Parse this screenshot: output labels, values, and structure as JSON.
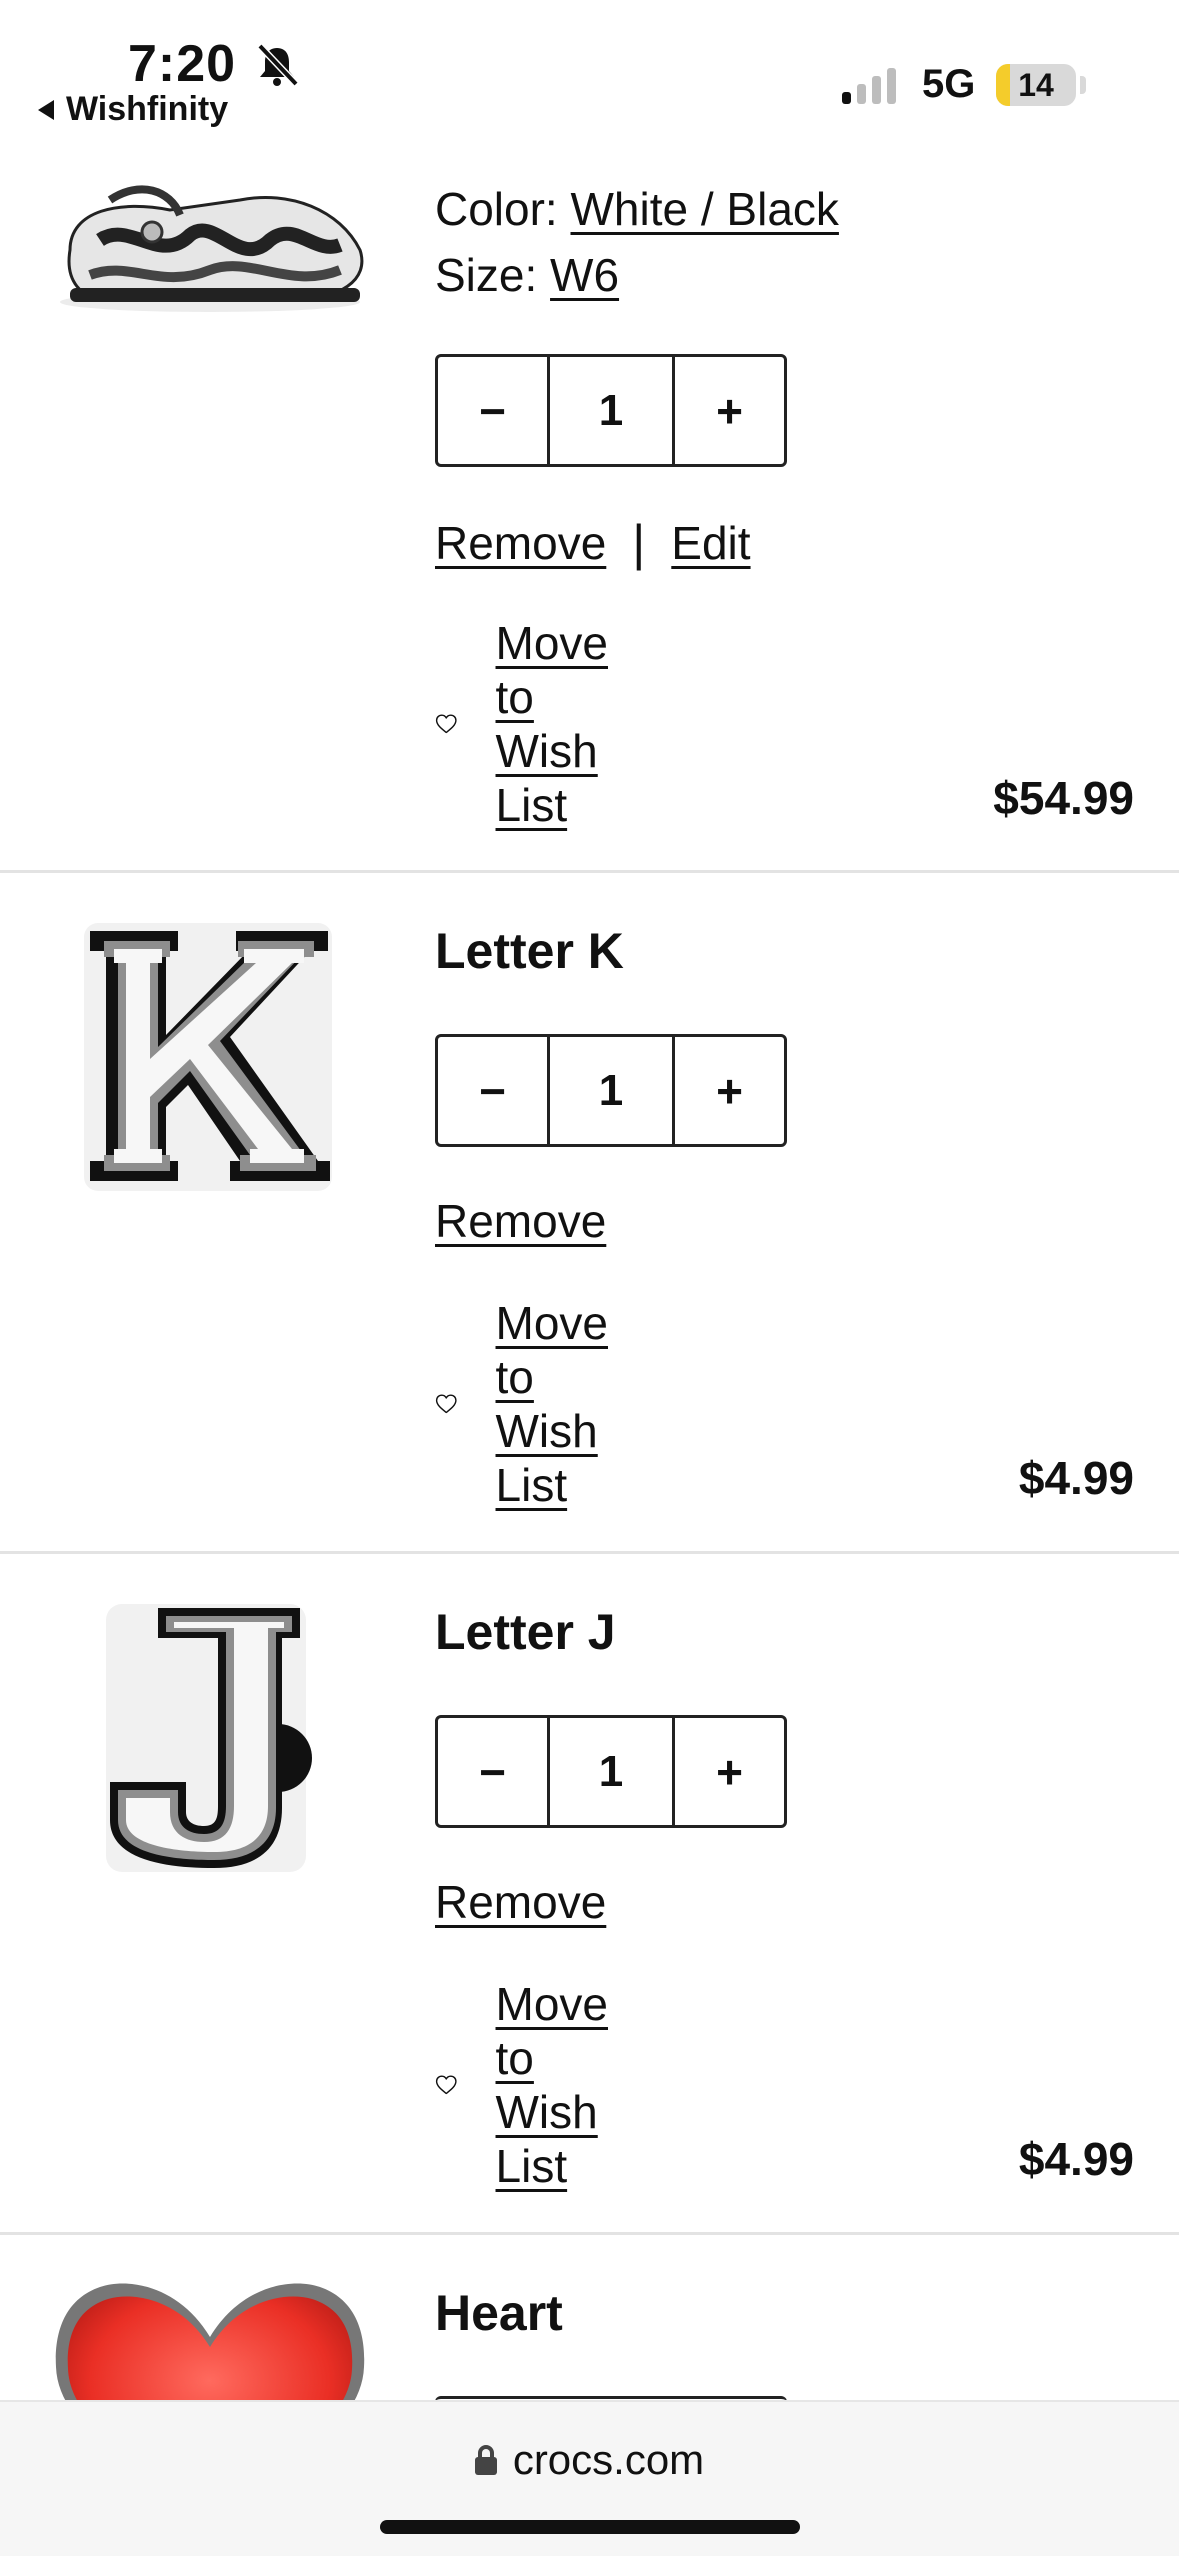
{
  "status_bar": {
    "time": "7:20",
    "back_app": "Wishfinity",
    "network": "5G",
    "battery": "14"
  },
  "items": [
    {
      "color_label": "Color:",
      "color_value": "White / Black",
      "size_label": "Size:",
      "size_value": "W6",
      "qty_minus": "−",
      "qty": "1",
      "qty_plus": "+",
      "remove": "Remove",
      "separator": "|",
      "edit": "Edit",
      "wish": "Move to Wish List",
      "price": "$54.99"
    },
    {
      "name": "Letter K",
      "qty_minus": "−",
      "qty": "1",
      "qty_plus": "+",
      "remove": "Remove",
      "wish": "Move to Wish List",
      "price": "$4.99"
    },
    {
      "name": "Letter J",
      "qty_minus": "−",
      "qty": "1",
      "qty_plus": "+",
      "remove": "Remove",
      "wish": "Move to Wish List",
      "price": "$4.99"
    },
    {
      "name": "Heart"
    }
  ],
  "browser": {
    "url": "crocs.com"
  }
}
